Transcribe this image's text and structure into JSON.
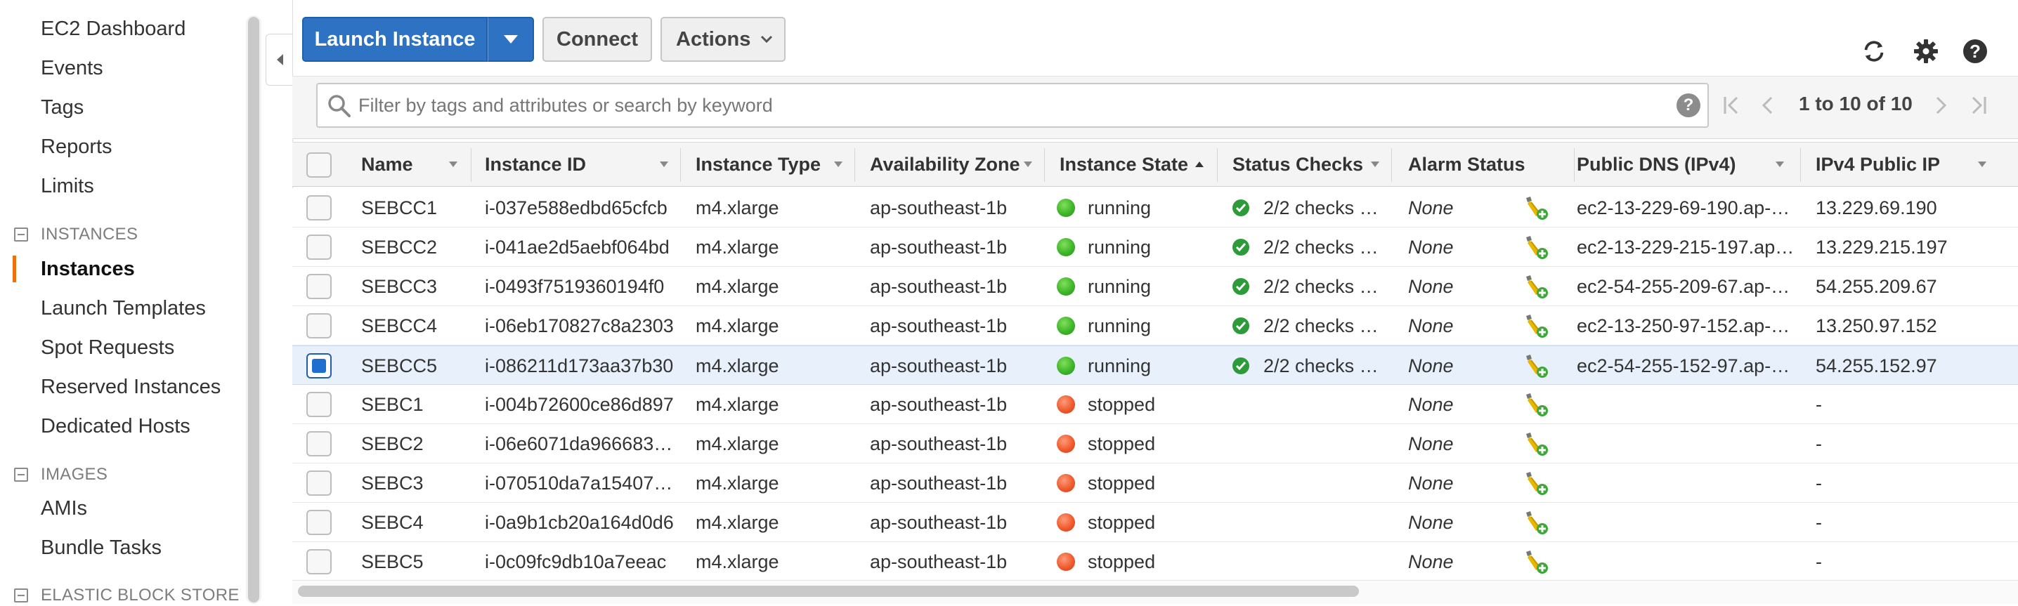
{
  "sidebar": {
    "top_items": [
      {
        "label": "EC2 Dashboard"
      },
      {
        "label": "Events"
      },
      {
        "label": "Tags"
      },
      {
        "label": "Reports"
      },
      {
        "label": "Limits"
      }
    ],
    "sections": [
      {
        "title": "INSTANCES",
        "items": [
          "Instances",
          "Launch Templates",
          "Spot Requests",
          "Reserved Instances",
          "Dedicated Hosts"
        ]
      },
      {
        "title": "IMAGES",
        "items": [
          "AMIs",
          "Bundle Tasks"
        ]
      },
      {
        "title": "ELASTIC BLOCK STORE",
        "items": []
      }
    ],
    "active_item": "Instances",
    "accent_color": "#ec7211"
  },
  "toolbar": {
    "launch_label": "Launch Instance",
    "connect_label": "Connect",
    "actions_label": "Actions",
    "icons": [
      "refresh-icon",
      "settings-gear-icon",
      "help-icon"
    ]
  },
  "filter": {
    "placeholder": "Filter by tags and attributes or search by keyword",
    "value": "",
    "help_glyph": "?"
  },
  "pagination": {
    "text": "1 to 10 of 10"
  },
  "table": {
    "columns": [
      "Name",
      "Instance ID",
      "Instance Type",
      "Availability Zone",
      "Instance State",
      "Status Checks",
      "Alarm Status",
      "Public DNS (IPv4)",
      "IPv4 Public IP"
    ],
    "sorted_column": "Instance State",
    "rows": [
      {
        "name": "SEBCC1",
        "id": "i-037e588edbd65cfcb",
        "type": "m4.xlarge",
        "az": "ap-southeast-1b",
        "state": "running",
        "checks": "2/2 checks …",
        "alarm": "None",
        "dns": "ec2-13-229-69-190.ap-…",
        "ip": "13.229.69.190",
        "selected": false
      },
      {
        "name": "SEBCC2",
        "id": "i-041ae2d5aebf064bd",
        "type": "m4.xlarge",
        "az": "ap-southeast-1b",
        "state": "running",
        "checks": "2/2 checks …",
        "alarm": "None",
        "dns": "ec2-13-229-215-197.ap…",
        "ip": "13.229.215.197",
        "selected": false
      },
      {
        "name": "SEBCC3",
        "id": "i-0493f7519360194f0",
        "type": "m4.xlarge",
        "az": "ap-southeast-1b",
        "state": "running",
        "checks": "2/2 checks …",
        "alarm": "None",
        "dns": "ec2-54-255-209-67.ap-…",
        "ip": "54.255.209.67",
        "selected": false
      },
      {
        "name": "SEBCC4",
        "id": "i-06eb170827c8a2303",
        "type": "m4.xlarge",
        "az": "ap-southeast-1b",
        "state": "running",
        "checks": "2/2 checks …",
        "alarm": "None",
        "dns": "ec2-13-250-97-152.ap-…",
        "ip": "13.250.97.152",
        "selected": false
      },
      {
        "name": "SEBCC5",
        "id": "i-086211d173aa37b30",
        "type": "m4.xlarge",
        "az": "ap-southeast-1b",
        "state": "running",
        "checks": "2/2 checks …",
        "alarm": "None",
        "dns": "ec2-54-255-152-97.ap-…",
        "ip": "54.255.152.97",
        "selected": true
      },
      {
        "name": "SEBC1",
        "id": "i-004b72600ce86d897",
        "type": "m4.xlarge",
        "az": "ap-southeast-1b",
        "state": "stopped",
        "checks": "",
        "alarm": "None",
        "dns": "",
        "ip": "-",
        "selected": false
      },
      {
        "name": "SEBC2",
        "id": "i-06e6071da966683…",
        "type": "m4.xlarge",
        "az": "ap-southeast-1b",
        "state": "stopped",
        "checks": "",
        "alarm": "None",
        "dns": "",
        "ip": "-",
        "selected": false
      },
      {
        "name": "SEBC3",
        "id": "i-070510da7a15407…",
        "type": "m4.xlarge",
        "az": "ap-southeast-1b",
        "state": "stopped",
        "checks": "",
        "alarm": "None",
        "dns": "",
        "ip": "-",
        "selected": false
      },
      {
        "name": "SEBC4",
        "id": "i-0a9b1cb20a164d0d6",
        "type": "m4.xlarge",
        "az": "ap-southeast-1b",
        "state": "stopped",
        "checks": "",
        "alarm": "None",
        "dns": "",
        "ip": "-",
        "selected": false
      },
      {
        "name": "SEBC5",
        "id": "i-0c09fc9db10a7eeac",
        "type": "m4.xlarge",
        "az": "ap-southeast-1b",
        "state": "stopped",
        "checks": "",
        "alarm": "None",
        "dns": "",
        "ip": "-",
        "selected": false
      }
    ]
  },
  "colors": {
    "primary_button": "#2e73c3",
    "running": "#3fb52a",
    "stopped": "#ef5b2e",
    "selected_row": "#e8f1fb",
    "check_ok": "#2e9b3a"
  }
}
